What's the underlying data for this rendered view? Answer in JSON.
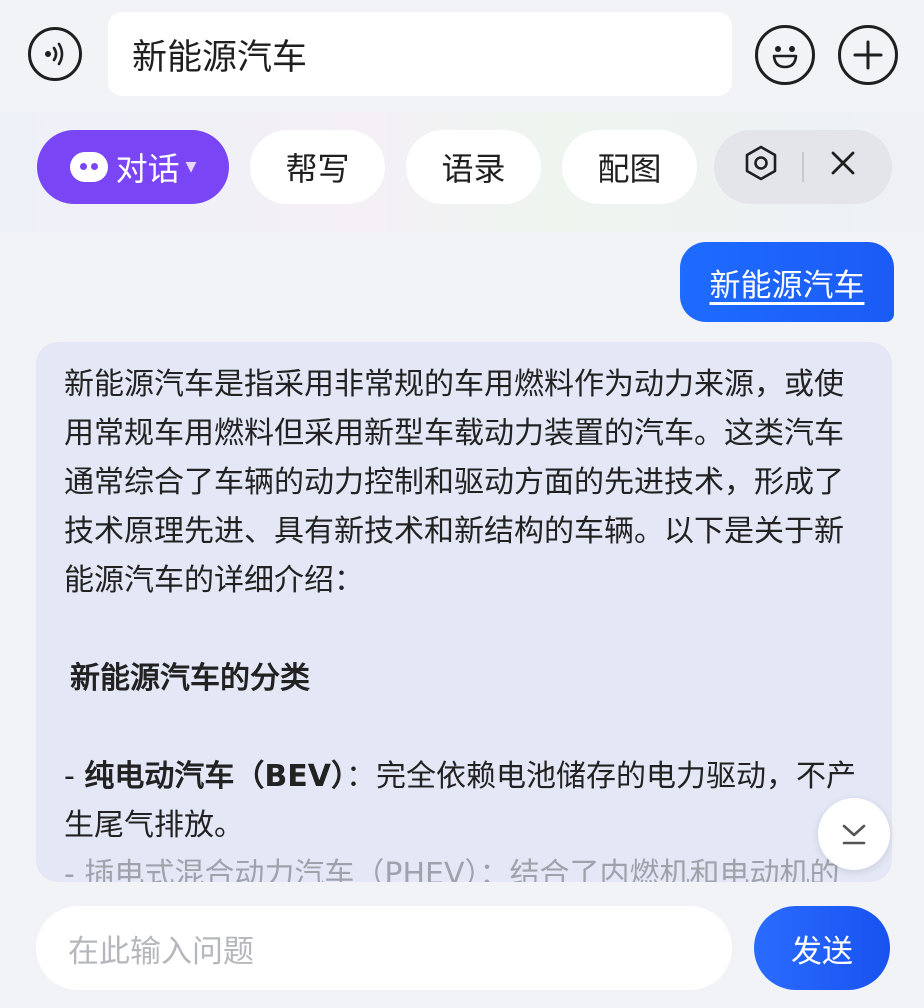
{
  "header": {
    "query_text": "新能源汽车"
  },
  "toolbar": {
    "chat_label": "对话",
    "write_label": "帮写",
    "quote_label": "语录",
    "image_label": "配图"
  },
  "conversation": {
    "user_message": "新能源汽车",
    "bot_paragraphs": [
      "新能源汽车是指采用非常规的车用燃料作为动力来源，或使用常规车用燃料但采用新型车载动力装置的汽车。这类汽车通常综合了车辆的动力控制和驱动方面的先进技术，形成了技术原理先进、具有新技术和新结构的车辆。以下是关于新能源汽车的详细介绍："
    ],
    "bot_heading": "新能源汽车的分类",
    "bot_item1_title": "纯电动汽车（BEV）",
    "bot_item1_text": "：完全依赖电池储存的电力驱动，不产生尾气排放。",
    "bot_item2_partial": "- 插电式混合动力汽车（PHEV）：结合了内燃机和电动机的"
  },
  "composer": {
    "placeholder": "在此输入问题",
    "send_label": "发送"
  },
  "colors": {
    "accent_purple": "#7a45f5",
    "accent_blue": "#1e6bff",
    "bot_bubble": "#e4e8f6"
  }
}
